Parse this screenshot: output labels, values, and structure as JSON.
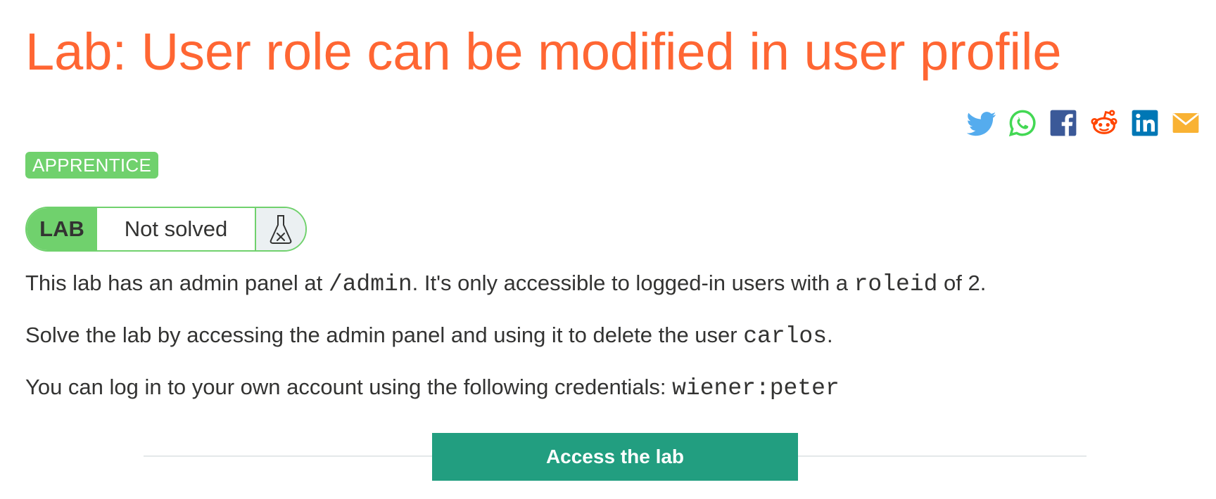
{
  "title": "Lab: User role can be modified in user profile",
  "share_icons": [
    {
      "name": "twitter-icon",
      "color": "#55acee"
    },
    {
      "name": "whatsapp-icon",
      "color": "#43d854"
    },
    {
      "name": "facebook-icon",
      "color": "#3b5998"
    },
    {
      "name": "reddit-icon",
      "color": "#ff4500"
    },
    {
      "name": "linkedin-icon",
      "color": "#0077b5"
    },
    {
      "name": "email-icon",
      "color": "#f9b233"
    }
  ],
  "level": "APPRENTICE",
  "status": {
    "label": "LAB",
    "value": "Not solved",
    "icon": "flask-icon"
  },
  "description": {
    "p1": {
      "before": "This lab has an admin panel at ",
      "code1": "/admin",
      "middle": ". It's only accessible to logged-in users with a ",
      "code2": "roleid",
      "after": " of 2."
    },
    "p2": {
      "before": "Solve the lab by accessing the admin panel and using it to delete the user ",
      "code": "carlos",
      "after": "."
    },
    "p3": {
      "before": "You can log in to your own account using the following credentials: ",
      "code": "wiener:peter"
    }
  },
  "access_button": "Access the lab",
  "colors": {
    "title": "#ff6633",
    "badge": "#70d16d",
    "button": "#229e80"
  }
}
